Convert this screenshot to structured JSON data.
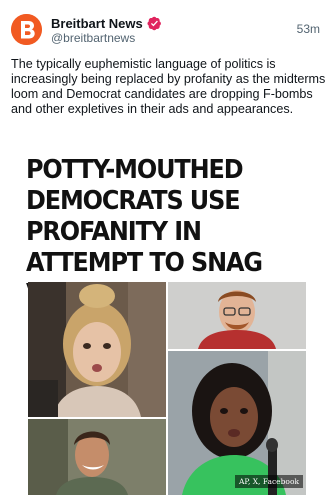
{
  "account": {
    "display_name": "Breitbart News",
    "handle": "@breitbartnews",
    "avatar_icon": "breitbart-b-logo-icon",
    "verified_icon": "verified-badge-icon",
    "brand_color": "#f15a22",
    "verified_color": "#e0245e"
  },
  "post": {
    "time": "53m",
    "text": "The typically euphemistic language of politics is increasingly being replaced by profanity as the midterms loom and Democrat candidates are dropping F-bombs and other expletives in their ads and appearances."
  },
  "media": {
    "headline": "Potty-Mouthed Democrats Use Profanity in Attempt to Snag Votes",
    "photo_credit": "AP, X, Facebook"
  }
}
